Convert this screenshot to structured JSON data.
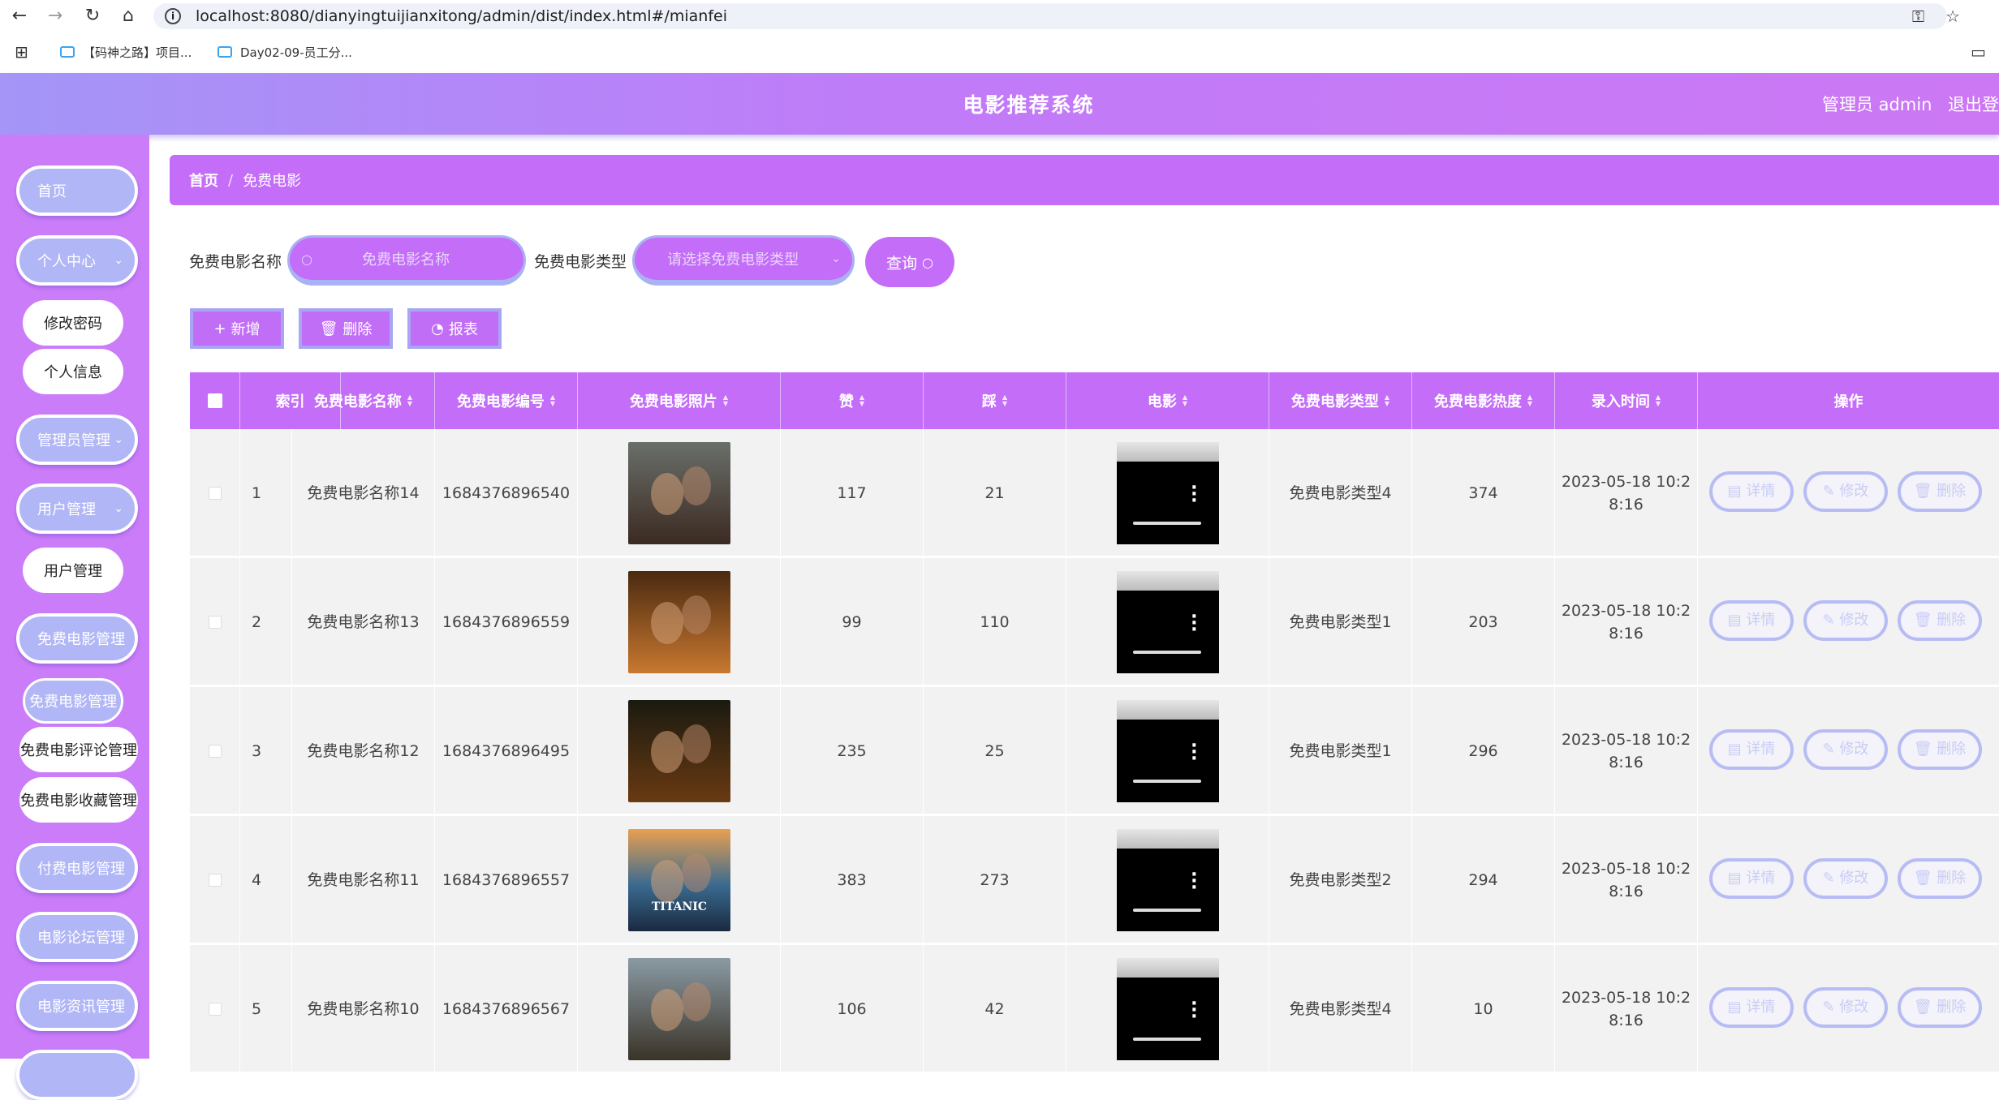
{
  "browser": {
    "url": "localhost:8080/dianyingtuijianxitong/admin/dist/index.html#/mianfei",
    "bookmarks": [
      "【码神之路】项目...",
      "Day02-09-员工分..."
    ]
  },
  "header": {
    "title": "电影推荐系统",
    "user": "管理员 admin",
    "logout": "退出登录"
  },
  "sidebar": {
    "home": "首页",
    "personal": "个人中心",
    "change_password": "修改密码",
    "profile": "个人信息",
    "admin_mgmt": "管理员管理",
    "user_mgmt": "用户管理",
    "user_mgmt_sub": "用户管理",
    "free_movie_mgmt": "免费电影管理",
    "free_movie_sub": "免费电影管理",
    "free_comment_mgmt": "免费电影评论管理",
    "free_fav_mgmt": "免费电影收藏管理",
    "paid_movie_mgmt": "付费电影管理",
    "forum_mgmt": "电影论坛管理",
    "news_mgmt": "电影资讯管理"
  },
  "breadcrumb": {
    "home": "首页",
    "sep": "/",
    "current": "免费电影"
  },
  "search": {
    "name_label": "免费电影名称",
    "name_placeholder": "免费电影名称",
    "type_label": "免费电影类型",
    "type_placeholder": "请选择免费电影类型",
    "query": "查询"
  },
  "actions": {
    "add": "新增",
    "delete": "删除",
    "report": "报表"
  },
  "table": {
    "headers": [
      "索引",
      "免费电影名称",
      "免费电影编号",
      "免费电影照片",
      "赞",
      "踩",
      "电影",
      "免费电影类型",
      "免费电影热度",
      "录入时间",
      "操作"
    ],
    "row_buttons": {
      "detail": "详情",
      "edit": "修改",
      "delete": "删除"
    },
    "rows": [
      {
        "index": "1",
        "name": "免费电影名称14",
        "code": "1684376896540",
        "likes": "117",
        "dislikes": "21",
        "type": "免费电影类型4",
        "heat": "374",
        "time": "2023-05-18 10:2\n8:16"
      },
      {
        "index": "2",
        "name": "免费电影名称13",
        "code": "1684376896559",
        "likes": "99",
        "dislikes": "110",
        "type": "免费电影类型1",
        "heat": "203",
        "time": "2023-05-18 10:2\n8:16"
      },
      {
        "index": "3",
        "name": "免费电影名称12",
        "code": "1684376896495",
        "likes": "235",
        "dislikes": "25",
        "type": "免费电影类型1",
        "heat": "296",
        "time": "2023-05-18 10:2\n8:16"
      },
      {
        "index": "4",
        "name": "免费电影名称11",
        "code": "1684376896557",
        "likes": "383",
        "dislikes": "273",
        "type": "免费电影类型2",
        "heat": "294",
        "time": "2023-05-18 10:2\n8:16"
      },
      {
        "index": "5",
        "name": "免费电影名称10",
        "code": "1684376896567",
        "likes": "106",
        "dislikes": "42",
        "type": "免费电影类型4",
        "heat": "10",
        "time": "2023-05-18 10:2\n8:16"
      }
    ],
    "poster_caption": "TITANIC"
  },
  "colors": {
    "primary": "#c46df8",
    "border": "#a8b2f4",
    "sidebar": "#cb7cf8"
  }
}
